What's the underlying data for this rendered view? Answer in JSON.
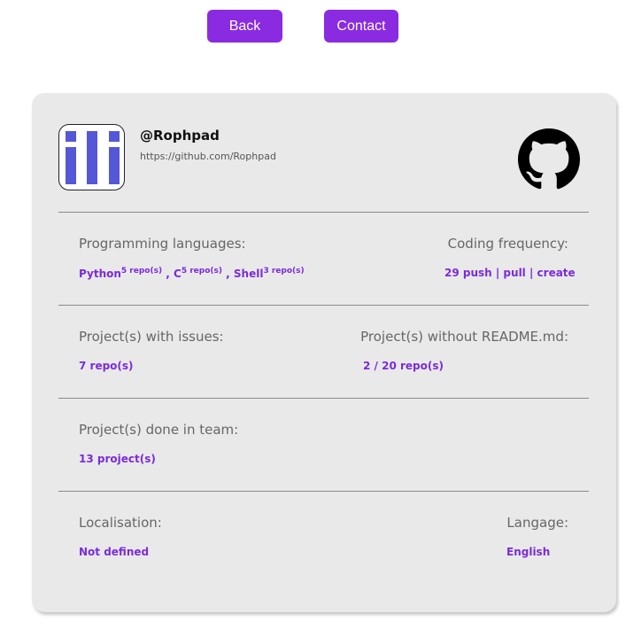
{
  "nav": {
    "back_label": "Back",
    "contact_label": "Contact"
  },
  "profile": {
    "username": "@Rophpad",
    "url": "https://github.com/Rophpad"
  },
  "languages": {
    "label": "Programming languages:",
    "items": [
      {
        "name": "Python",
        "count": "5 repo(s)"
      },
      {
        "name": "C",
        "count": "5 repo(s)"
      },
      {
        "name": "Shell",
        "count": "3 repo(s)"
      }
    ],
    "separator": ","
  },
  "frequency": {
    "label": "Coding frequency:",
    "value": "29 push | pull | create"
  },
  "issues": {
    "label": "Project(s) with issues:",
    "value": "7 repo(s)"
  },
  "readme": {
    "label": "Project(s) without README.md:",
    "value": "2 / 20 repo(s)"
  },
  "team": {
    "label": "Project(s) done in team:",
    "value": "13 project(s)"
  },
  "location": {
    "label": "Localisation:",
    "value": "Not defined"
  },
  "language": {
    "label": "Langage:",
    "value": "English"
  },
  "colors": {
    "accent": "#8a2be2",
    "card_bg": "#e9e9ea",
    "avatar_blue": "#5558d6"
  }
}
